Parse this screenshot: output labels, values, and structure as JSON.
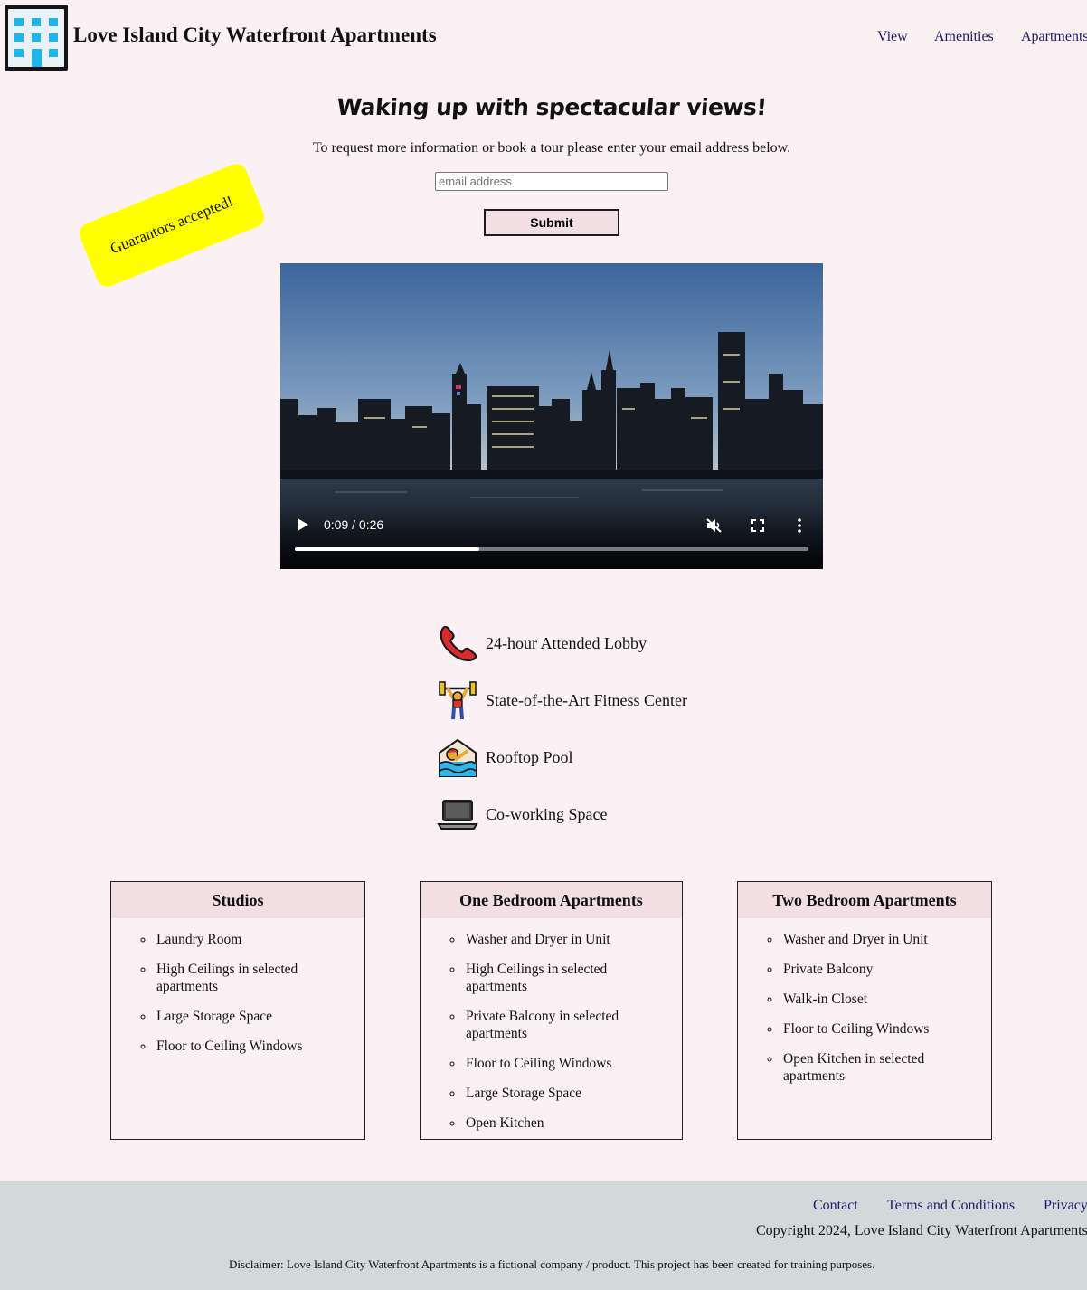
{
  "header": {
    "title": "Love Island City Waterfront Apartments",
    "logo_icon": "office-building-icon",
    "nav": [
      "View",
      "Amenities",
      "Apartments"
    ]
  },
  "hero": {
    "title": "Waking up with spectacular views!",
    "text": "To request more information or book a tour please enter your email address below.",
    "email_placeholder": "email address",
    "submit_label": "Submit",
    "badge": "Guarantors accepted!"
  },
  "video": {
    "time": "0:09 / 0:26",
    "progress": 0.36,
    "muted": true,
    "controls": [
      "play-icon",
      "mute-icon",
      "fullscreen-icon",
      "more-options-icon"
    ]
  },
  "amenities": [
    {
      "icon": "telephone-icon",
      "label": "24-hour Attended Lobby"
    },
    {
      "icon": "weightlifting-icon",
      "label": "State-of-the-Art Fitness Center"
    },
    {
      "icon": "swimming-pool-icon",
      "label": "Rooftop Pool"
    },
    {
      "icon": "laptop-icon",
      "label": "Co-working Space"
    }
  ],
  "cards": [
    {
      "title": "Studios",
      "items": [
        "Laundry Room",
        "High Ceilings in selected apartments",
        "Large Storage Space",
        "Floor to Ceiling Windows"
      ]
    },
    {
      "title": "One Bedroom Apartments",
      "items": [
        "Washer and Dryer in Unit",
        "High Ceilings in selected apartments",
        "Private Balcony in selected apartments",
        "Floor to Ceiling Windows",
        "Large Storage Space",
        "Open Kitchen"
      ]
    },
    {
      "title": "Two Bedroom Apartments",
      "items": [
        "Washer and Dryer in Unit",
        "Private Balcony",
        "Walk-in Closet",
        "Floor to Ceiling Windows",
        "Open Kitchen in selected apartments"
      ]
    }
  ],
  "footer": {
    "links": [
      "Contact",
      "Terms and Conditions",
      "Privacy"
    ],
    "copyright": "Copyright 2024, Love Island City Waterfront Apartments",
    "disclaimer": "Disclaimer: Love Island City Waterfront Apartments is a fictional company / product. This project has been created for training purposes."
  },
  "colors": {
    "background": "#fbf0f3",
    "card_header": "#f1dfe4",
    "badge": "#ffff00",
    "footer": "#d1d9db",
    "link": "#1d1a6b"
  }
}
